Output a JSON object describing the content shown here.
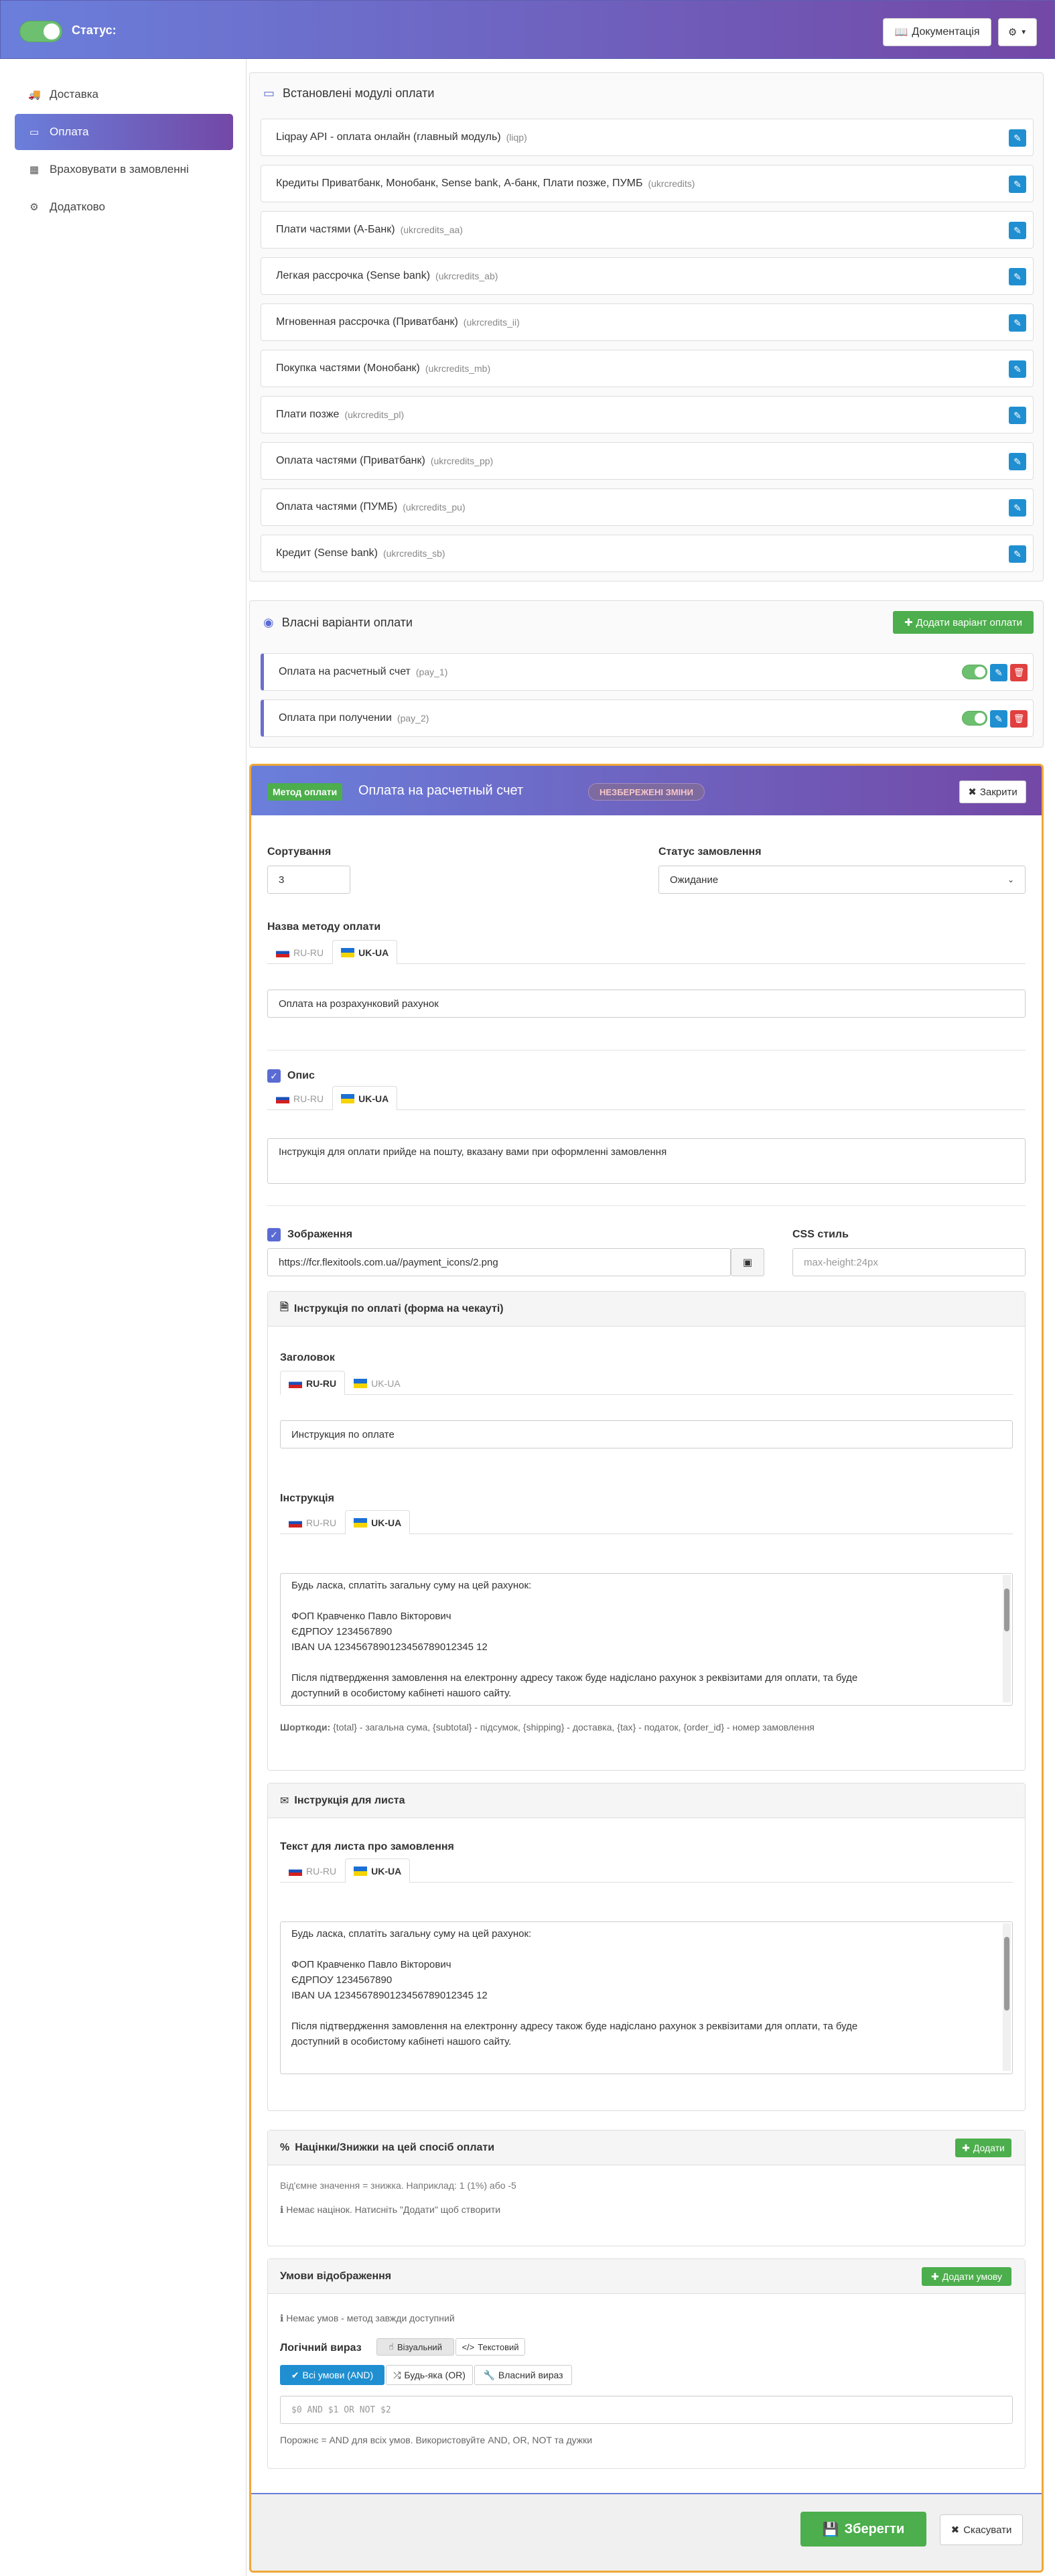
{
  "topbar": {
    "status_label": "Статус:",
    "docs_label": "Документація",
    "status_enabled": true
  },
  "sidebar": {
    "items": [
      {
        "label": "Доставка",
        "icon": "truck-icon"
      },
      {
        "label": "Оплата",
        "icon": "card-icon",
        "active": true
      },
      {
        "label": "Враховувати в замовленні",
        "icon": "calculator-icon"
      },
      {
        "label": "Додатково",
        "icon": "cogs-icon"
      }
    ]
  },
  "installed": {
    "title": "Встановлені модулі оплати",
    "modules": [
      {
        "name": "Liqpay API - оплата онлайн (главный модуль)",
        "code": "(liqp)"
      },
      {
        "name": "Кредиты Приватбанк, Монобанк, Sense bank, А-банк, Плати позже, ПУМБ",
        "code": "(ukrcredits)"
      },
      {
        "name": "Плати частями (А-Банк)",
        "code": "(ukrcredits_aa)"
      },
      {
        "name": "Легкая рассрочка (Sense bank)",
        "code": "(ukrcredits_ab)"
      },
      {
        "name": "Мгновенная рассрочка (Приватбанк)",
        "code": "(ukrcredits_ii)"
      },
      {
        "name": "Покупка частями (Монобанк)",
        "code": "(ukrcredits_mb)"
      },
      {
        "name": "Плати позже",
        "code": "(ukrcredits_pl)"
      },
      {
        "name": "Оплата частями (Приватбанк)",
        "code": "(ukrcredits_pp)"
      },
      {
        "name": "Оплата частями (ПУМБ)",
        "code": "(ukrcredits_pu)"
      },
      {
        "name": "Кредит (Sense bank)",
        "code": "(ukrcredits_sb)"
      }
    ]
  },
  "custom": {
    "title": "Власні варіанти оплати",
    "add_label": "Додати варіант оплати",
    "items": [
      {
        "name": "Оплата на расчетный счет",
        "code": "(pay_1)",
        "enabled": true
      },
      {
        "name": "Оплата при получении",
        "code": "(pay_2)",
        "enabled": true
      }
    ]
  },
  "editor": {
    "badge": "Метод оплати",
    "title": "Оплата на расчетный счет",
    "unsaved": "НЕЗБЕРЕЖЕНІ ЗМІНИ",
    "close_label": "Закрити",
    "sort_label": "Сортування",
    "sort_value": "3",
    "order_status_label": "Статус замовлення",
    "order_status_value": "Ожидание",
    "name_label": "Назва методу оплати",
    "lang_ru": "RU-RU",
    "lang_ua": "UK-UA",
    "name_value": "Оплата на розрахунковий рахунок",
    "desc_label": "Опис",
    "desc_value": "Інструкція для оплати прийде на пошту, вказану вами при оформленні замовлення",
    "image_label": "Зображення",
    "image_value": "https://fcr.flexitools.com.ua//payment_icons/2.png",
    "css_label": "CSS стиль",
    "css_placeholder": "max-height:24px",
    "checkout": {
      "title": "Інструкція по оплаті (форма на чекауті)",
      "heading_label": "Заголовок",
      "heading_value": "Инструкция по оплате",
      "instr_label": "Інструкція",
      "text_lines": [
        "Будь ласка, сплатіть загальну суму на цей рахунок:",
        "",
        "ФОП Кравченко Павло Вікторович",
        "ЄДРПОУ 1234567890",
        "IBAN UA 1234567890123456789012345 12",
        "",
        "Після підтвердження замовлення на електронну адресу також буде надіслано рахунок з реквізитами для оплати, та буде",
        "доступний в особистому кабінеті нашого сайту."
      ],
      "shortcodes_label": "Шорткоди:",
      "shortcodes_text": "{total} - загальна сума, {subtotal} - підсумок, {shipping} - доставка, {tax} - податок, {order_id} - номер замовлення"
    },
    "email": {
      "title": "Інструкція для листа",
      "label": "Текст для листа про замовлення",
      "text_lines": [
        "Будь ласка, сплатіть загальну суму на цей рахунок:",
        "",
        "ФОП Кравченко Павло Вікторович",
        "ЄДРПОУ 1234567890",
        "IBAN UA 1234567890123456789012345 12",
        "",
        "Після підтвердження замовлення на електронну адресу також буде надіслано рахунок з реквізитами для оплати, та буде",
        "доступний в особистому кабінеті нашого сайту."
      ]
    },
    "markup": {
      "title": "Націнки/Знижки на цей спосіб оплати",
      "add_label": "Додати",
      "hint": "Від'ємне значення = знижка. Наприклад: 1 (1%) або -5",
      "empty": "Немає націнок. Натисніть \"Додати\" щоб створити"
    },
    "conditions": {
      "title": "Умови відображення",
      "add_label": "Додати умову",
      "empty": "Немає умов - метод завжди доступний",
      "logic_label": "Логічний вираз",
      "visual_label": "Візуальний",
      "text_label": "Текстовий",
      "all_label": "Всі умови (AND)",
      "any_label": "Будь-яка (OR)",
      "custom_label": "Власний вираз",
      "expr_placeholder": "$0 AND $1 OR NOT $2",
      "hint": "Порожнє = AND для всіх умов. Використовуйте AND, OR, NOT та дужки"
    },
    "save_label": "Зберегти",
    "cancel_label": "Скасувати"
  }
}
